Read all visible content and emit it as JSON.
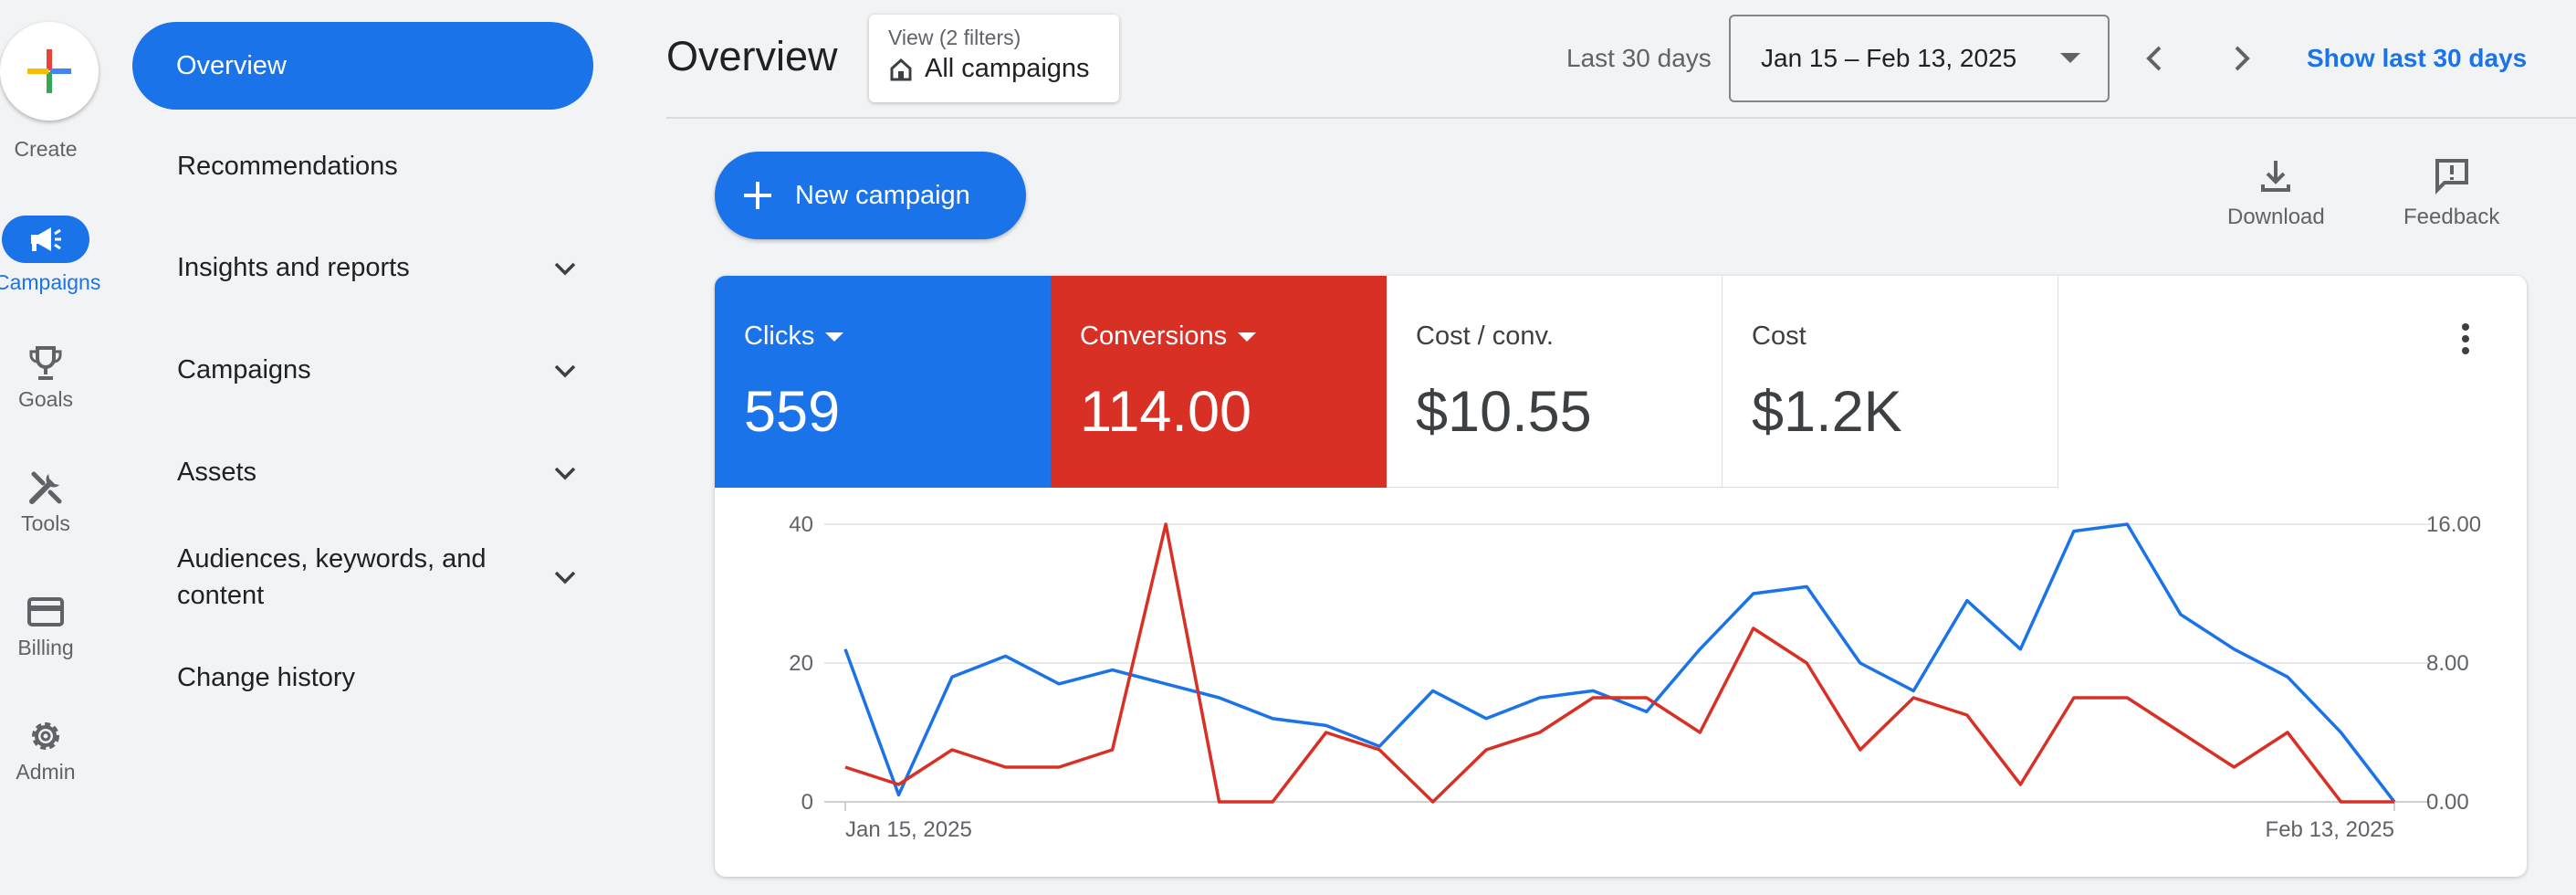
{
  "rail": {
    "create": "Create",
    "campaigns": "Campaigns",
    "goals": "Goals",
    "tools": "Tools",
    "billing": "Billing",
    "admin": "Admin"
  },
  "sidenav": {
    "overview": "Overview",
    "recommendations": "Recommendations",
    "insights": "Insights and reports",
    "campaigns": "Campaigns",
    "assets": "Assets",
    "audiences_line1": "Audiences, keywords, and",
    "audiences_line2": "content",
    "change_history": "Change history"
  },
  "header": {
    "title": "Overview",
    "view_small": "View (2 filters)",
    "view_main": "All campaigns",
    "period_label": "Last 30 days",
    "date_range": "Jan 15 – Feb 13, 2025",
    "show_link": "Show last 30 days"
  },
  "toolbar": {
    "new_campaign": "New campaign",
    "download": "Download",
    "feedback": "Feedback"
  },
  "metrics": [
    {
      "label": "Clicks",
      "value": "559",
      "color": "#1a73e8"
    },
    {
      "label": "Conversions",
      "value": "114.00",
      "color": "#d93025"
    },
    {
      "label": "Cost / conv.",
      "value": "$10.55"
    },
    {
      "label": "Cost",
      "value": "$1.2K"
    }
  ],
  "chart_data": {
    "type": "line",
    "x_start_label": "Jan 15, 2025",
    "x_end_label": "Feb 13, 2025",
    "x": [
      "Jan 15",
      "Jan 16",
      "Jan 17",
      "Jan 18",
      "Jan 19",
      "Jan 20",
      "Jan 21",
      "Jan 22",
      "Jan 23",
      "Jan 24",
      "Jan 25",
      "Jan 26",
      "Jan 27",
      "Jan 28",
      "Jan 29",
      "Jan 30",
      "Jan 31",
      "Feb 1",
      "Feb 2",
      "Feb 3",
      "Feb 4",
      "Feb 5",
      "Feb 6",
      "Feb 7",
      "Feb 8",
      "Feb 9",
      "Feb 10",
      "Feb 11",
      "Feb 12",
      "Feb 13"
    ],
    "left_axis": {
      "ticks": [
        "0",
        "20",
        "40"
      ],
      "range": [
        0,
        40
      ]
    },
    "right_axis": {
      "ticks": [
        "0.00",
        "8.00",
        "16.00"
      ],
      "range": [
        0,
        16
      ]
    },
    "grid": true,
    "series": [
      {
        "color": "#1a73e8",
        "axis": "left",
        "values": [
          22,
          1,
          18,
          21,
          17,
          19,
          17,
          15,
          12,
          11,
          8,
          16,
          12,
          15,
          16,
          13,
          22,
          30,
          31,
          20,
          16,
          29,
          22,
          39,
          40,
          27,
          22,
          18,
          10,
          0
        ]
      },
      {
        "color": "#d93025",
        "axis": "right",
        "values": [
          2,
          1,
          3,
          2,
          2,
          3,
          16,
          0,
          0,
          4,
          3,
          0,
          3,
          4,
          6,
          6,
          4,
          10,
          8,
          3,
          6,
          5,
          1,
          6,
          6,
          4,
          2,
          4,
          0,
          0
        ]
      }
    ]
  }
}
